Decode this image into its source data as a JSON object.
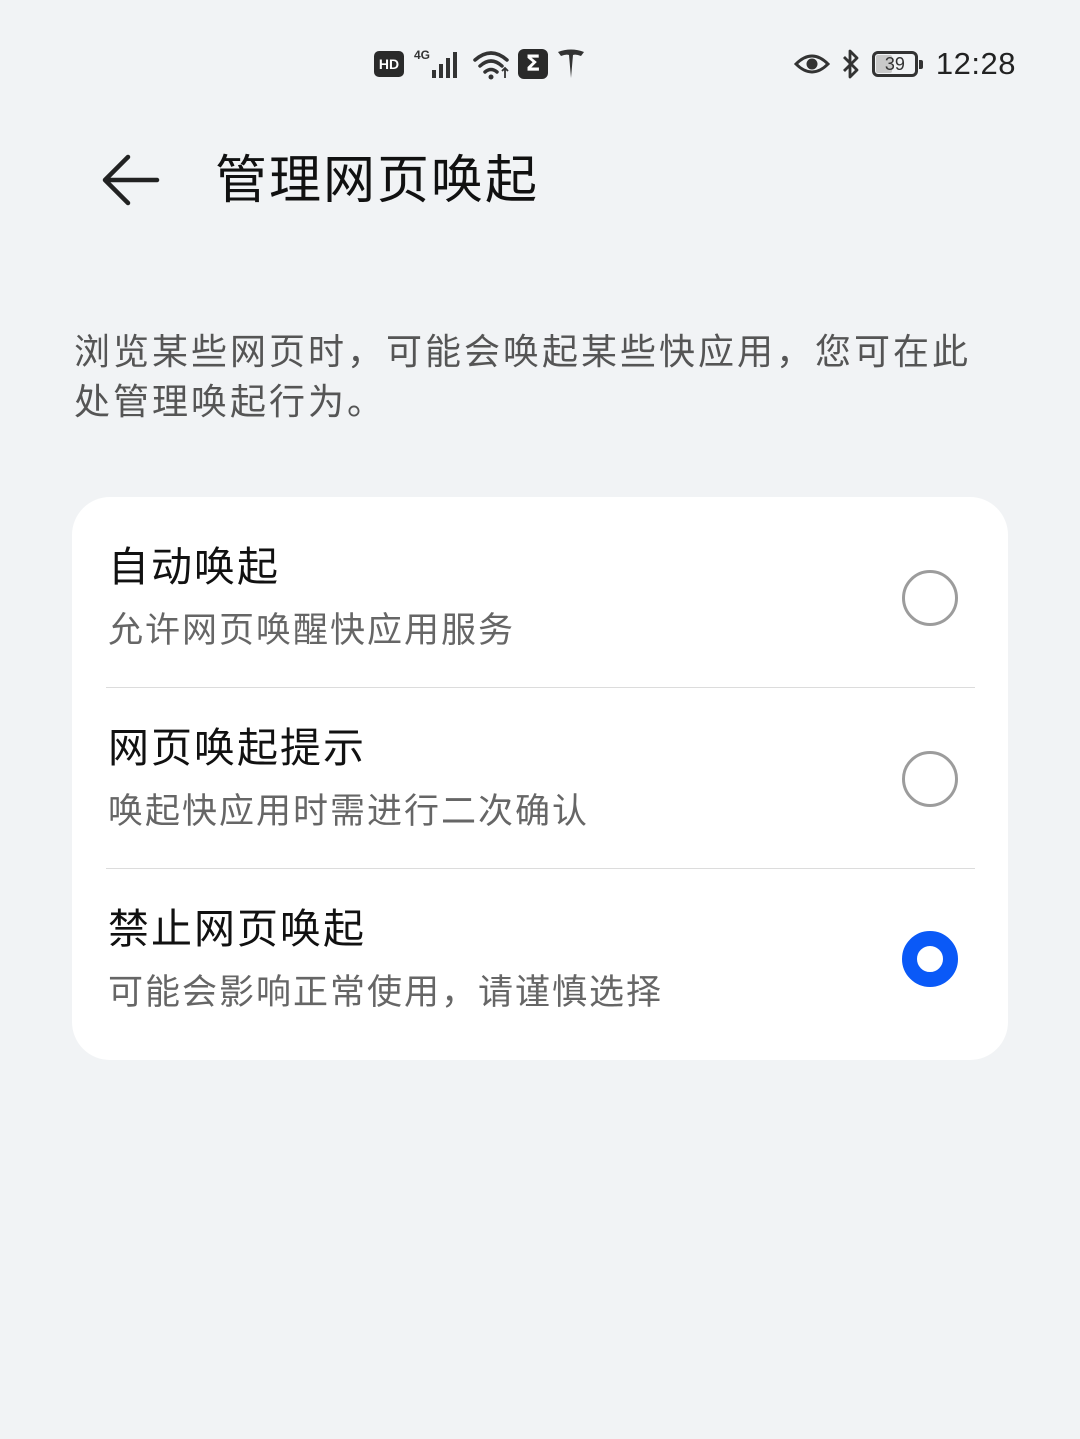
{
  "status_bar": {
    "time": "12:28",
    "battery_level": "39",
    "hd_label": "HD",
    "network_label": "4G",
    "sigma_label": "Σ",
    "icons": [
      "hd-icon",
      "signal-icon",
      "wifi-icon",
      "sigma-app-icon",
      "tesla-icon",
      "eye-icon",
      "bluetooth-icon",
      "battery-icon"
    ]
  },
  "header": {
    "title": "管理网页唤起"
  },
  "description": "浏览某些网页时，可能会唤起某些快应用，您可在此处管理唤起行为。",
  "options": [
    {
      "title": "自动唤起",
      "subtitle": "允许网页唤醒快应用服务",
      "selected": false
    },
    {
      "title": "网页唤起提示",
      "subtitle": "唤起快应用时需进行二次确认",
      "selected": false
    },
    {
      "title": "禁止网页唤起",
      "subtitle": "可能会影响正常使用，请谨慎选择",
      "selected": true
    }
  ],
  "colors": {
    "background": "#f1f3f5",
    "card": "#ffffff",
    "accent": "#0a59f7"
  }
}
